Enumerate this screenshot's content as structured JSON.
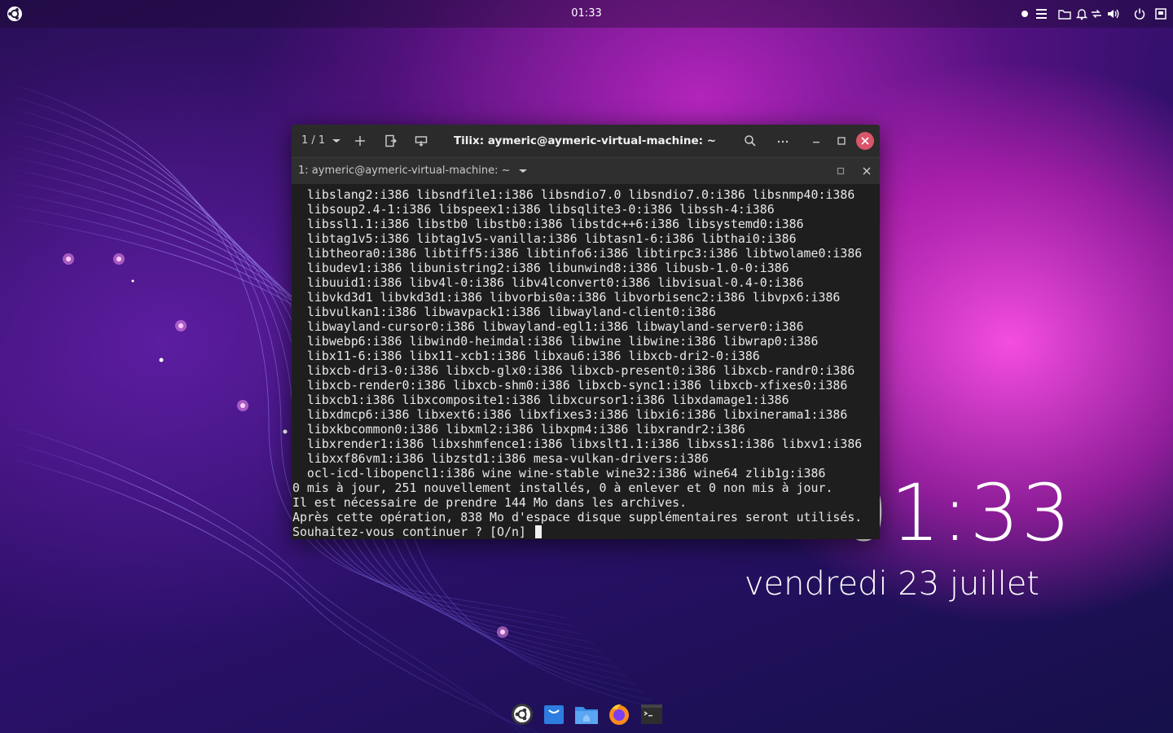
{
  "panel": {
    "time": "01:33"
  },
  "desktop_clock": {
    "time": "01:33",
    "date": "vendredi 23 juillet"
  },
  "tilix": {
    "session_count": "1 / 1",
    "title": "Tilix: aymeric@aymeric-virtual-machine: ~",
    "tab_title": "1: aymeric@aymeric-virtual-machine: ~",
    "output_lines": [
      "  libslang2:i386 libsndfile1:i386 libsndio7.0 libsndio7.0:i386 libsnmp40:i386",
      "  libsoup2.4-1:i386 libspeex1:i386 libsqlite3-0:i386 libssh-4:i386",
      "  libssl1.1:i386 libstb0 libstb0:i386 libstdc++6:i386 libsystemd0:i386",
      "  libtag1v5:i386 libtag1v5-vanilla:i386 libtasn1-6:i386 libthai0:i386",
      "  libtheora0:i386 libtiff5:i386 libtinfo6:i386 libtirpc3:i386 libtwolame0:i386",
      "  libudev1:i386 libunistring2:i386 libunwind8:i386 libusb-1.0-0:i386",
      "  libuuid1:i386 libv4l-0:i386 libv4lconvert0:i386 libvisual-0.4-0:i386",
      "  libvkd3d1 libvkd3d1:i386 libvorbis0a:i386 libvorbisenc2:i386 libvpx6:i386",
      "  libvulkan1:i386 libwavpack1:i386 libwayland-client0:i386",
      "  libwayland-cursor0:i386 libwayland-egl1:i386 libwayland-server0:i386",
      "  libwebp6:i386 libwind0-heimdal:i386 libwine libwine:i386 libwrap0:i386",
      "  libx11-6:i386 libx11-xcb1:i386 libxau6:i386 libxcb-dri2-0:i386",
      "  libxcb-dri3-0:i386 libxcb-glx0:i386 libxcb-present0:i386 libxcb-randr0:i386",
      "  libxcb-render0:i386 libxcb-shm0:i386 libxcb-sync1:i386 libxcb-xfixes0:i386",
      "  libxcb1:i386 libxcomposite1:i386 libxcursor1:i386 libxdamage1:i386",
      "  libxdmcp6:i386 libxext6:i386 libxfixes3:i386 libxi6:i386 libxinerama1:i386",
      "  libxkbcommon0:i386 libxml2:i386 libxpm4:i386 libxrandr2:i386",
      "  libxrender1:i386 libxshmfence1:i386 libxslt1.1:i386 libxss1:i386 libxv1:i386",
      "  libxxf86vm1:i386 libzstd1:i386 mesa-vulkan-drivers:i386",
      "  ocl-icd-libopencl1:i386 wine wine-stable wine32:i386 wine64 zlib1g:i386",
      "0 mis à jour, 251 nouvellement installés, 0 à enlever et 0 non mis à jour.",
      "Il est nécessaire de prendre 144 Mo dans les archives.",
      "Après cette opération, 838 Mo d'espace disque supplémentaires seront utilisés."
    ],
    "prompt_line": "Souhaitez-vous continuer ? [O/n] "
  },
  "icons": {
    "panel_left": "ubuntu-logo-icon",
    "panel_right": [
      "record-dot-icon",
      "menu-icon",
      "folder-icon",
      "bell-icon",
      "network-icon",
      "volume-icon",
      "power-icon",
      "window-switch-icon"
    ],
    "titlebar": [
      "chevron-down-icon",
      "plus-icon",
      "split-vertical-icon",
      "split-horizontal-icon",
      "search-icon",
      "more-icon",
      "minimize-icon",
      "maximize-icon",
      "close-icon"
    ],
    "dock": [
      "ubuntu-budgie-icon",
      "software-store-icon",
      "files-icon",
      "firefox-icon",
      "terminal-icon"
    ]
  },
  "colors": {
    "close_button": "#d8556a",
    "terminal_bg": "#1e1e1e",
    "titlebar_bg": "#2b2b2b"
  }
}
